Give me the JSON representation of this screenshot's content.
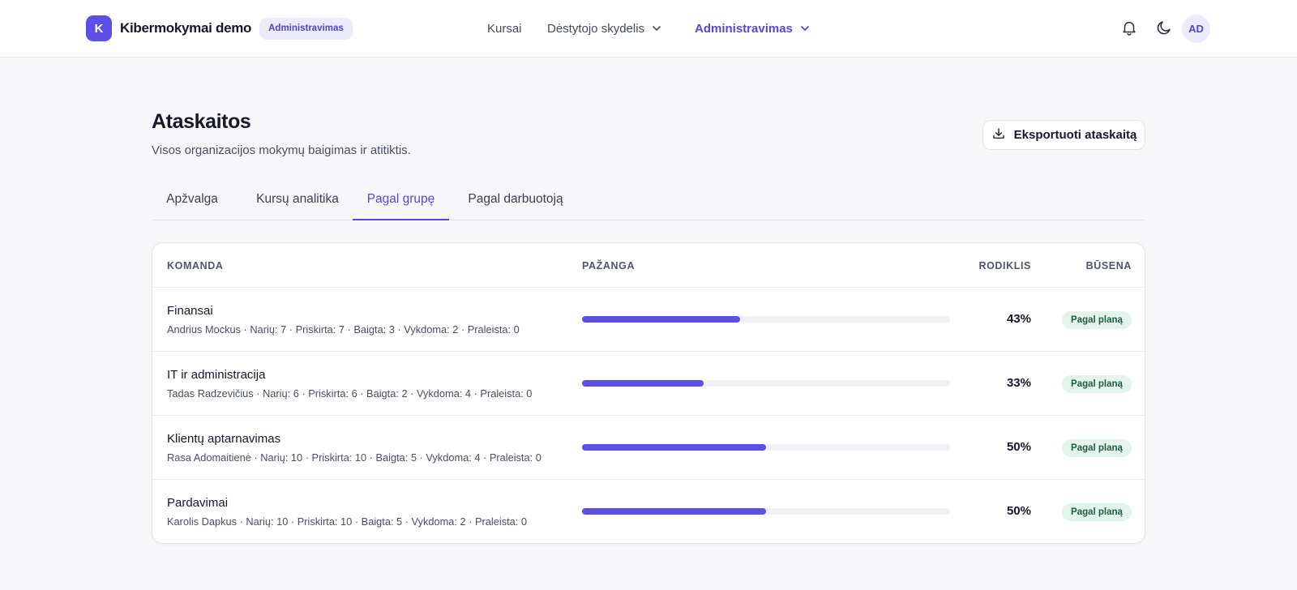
{
  "header": {
    "brand_initial": "K",
    "brand_name": "Kibermokymai demo",
    "role_badge": "Administravimas",
    "nav": {
      "courses": "Kursai",
      "instructor": "Dėstytojo skydelis",
      "admin": "Administravimas"
    },
    "avatar_initials": "AD",
    "icons": [
      "bell-icon",
      "moon-icon",
      "chevron-down-icon"
    ]
  },
  "page": {
    "title": "Ataskaitos",
    "subtitle": "Visos organizacijos mokymų baigimas ir atitiktis.",
    "export_label": "Eksportuoti ataskaitą"
  },
  "tabs": [
    {
      "label": "Apžvalga",
      "active": false
    },
    {
      "label": "Kursų analitika",
      "active": false
    },
    {
      "label": "Pagal grupę",
      "active": true
    },
    {
      "label": "Pagal darbuotoją",
      "active": false
    }
  ],
  "table": {
    "headers": {
      "team": "KOMANDA",
      "progress": "PAŽANGA",
      "metric": "RODIKLIS",
      "status": "BŪSENA"
    },
    "rows": [
      {
        "name": "Finansai",
        "meta": "Andrius Mockus · Narių: 7 · Priskirta: 7 · Baigta: 3 · Vykdoma: 2 · Praleista: 0",
        "progress": 0.43,
        "metric": "43%",
        "status": "Pagal planą"
      },
      {
        "name": "IT ir administracija",
        "meta": "Tadas Radzevičius · Narių: 6 · Priskirta: 6 · Baigta: 2 · Vykdoma: 4 · Praleista: 0",
        "progress": 0.33,
        "metric": "33%",
        "status": "Pagal planą"
      },
      {
        "name": "Klientų aptarnavimas",
        "meta": "Rasa Adomaitienė · Narių: 10 · Priskirta: 10 · Baigta: 5 · Vykdoma: 4 · Praleista: 0",
        "progress": 0.5,
        "metric": "50%",
        "status": "Pagal planą"
      },
      {
        "name": "Pardavimai",
        "meta": "Karolis Dapkus · Narių: 10 · Priskirta: 10 · Baigta: 5 · Vykdoma: 2 · Praleista: 0",
        "progress": 0.5,
        "metric": "50%",
        "status": "Pagal planą"
      }
    ]
  },
  "colors": {
    "accent": "#5b4fe6",
    "status_bg": "#e4f3ec",
    "status_text": "#1f5d43",
    "track": "#f0f0f5"
  }
}
